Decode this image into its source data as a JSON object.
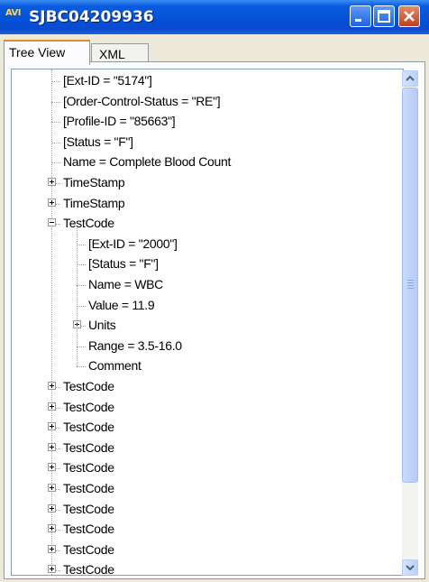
{
  "window": {
    "title": "SJBC04209936",
    "app_badge": "AVI"
  },
  "tabs": [
    {
      "label": "Tree View",
      "active": true
    },
    {
      "label": "XML",
      "active": false
    }
  ],
  "tree_rows": [
    {
      "label": "[Ext-ID = \"5174\"]",
      "level": 1,
      "expander": "none"
    },
    {
      "label": "[Order-Control-Status = \"RE\"]",
      "level": 1,
      "expander": "none"
    },
    {
      "label": "[Profile-ID = \"85663\"]",
      "level": 1,
      "expander": "none"
    },
    {
      "label": "[Status = \"F\"]",
      "level": 1,
      "expander": "none"
    },
    {
      "label": "Name = Complete Blood Count",
      "level": 1,
      "expander": "none"
    },
    {
      "label": "TimeStamp",
      "level": 1,
      "expander": "plus"
    },
    {
      "label": "TimeStamp",
      "level": 1,
      "expander": "plus"
    },
    {
      "label": "TestCode",
      "level": 1,
      "expander": "minus"
    },
    {
      "label": "[Ext-ID = \"2000\"]",
      "level": 2,
      "expander": "none"
    },
    {
      "label": "[Status = \"F\"]",
      "level": 2,
      "expander": "none"
    },
    {
      "label": "Name = WBC",
      "level": 2,
      "expander": "none"
    },
    {
      "label": "Value = 11.9",
      "level": 2,
      "expander": "none"
    },
    {
      "label": "Units",
      "level": 2,
      "expander": "plus"
    },
    {
      "label": "Range = 3.5-16.0",
      "level": 2,
      "expander": "none"
    },
    {
      "label": "Comment",
      "level": 2,
      "expander": "none"
    },
    {
      "label": "TestCode",
      "level": 1,
      "expander": "plus"
    },
    {
      "label": "TestCode",
      "level": 1,
      "expander": "plus"
    },
    {
      "label": "TestCode",
      "level": 1,
      "expander": "plus"
    },
    {
      "label": "TestCode",
      "level": 1,
      "expander": "plus"
    },
    {
      "label": "TestCode",
      "level": 1,
      "expander": "plus"
    },
    {
      "label": "TestCode",
      "level": 1,
      "expander": "plus"
    },
    {
      "label": "TestCode",
      "level": 1,
      "expander": "plus"
    },
    {
      "label": "TestCode",
      "level": 1,
      "expander": "plus"
    },
    {
      "label": "TestCode",
      "level": 1,
      "expander": "plus"
    },
    {
      "label": "TestCode",
      "level": 1,
      "expander": "plus"
    }
  ],
  "icons": {
    "minimize": "minimize-icon",
    "maximize": "maximize-icon",
    "close": "close-icon",
    "scroll_up": "chevron-up-icon",
    "scroll_down": "chevron-down-icon"
  }
}
